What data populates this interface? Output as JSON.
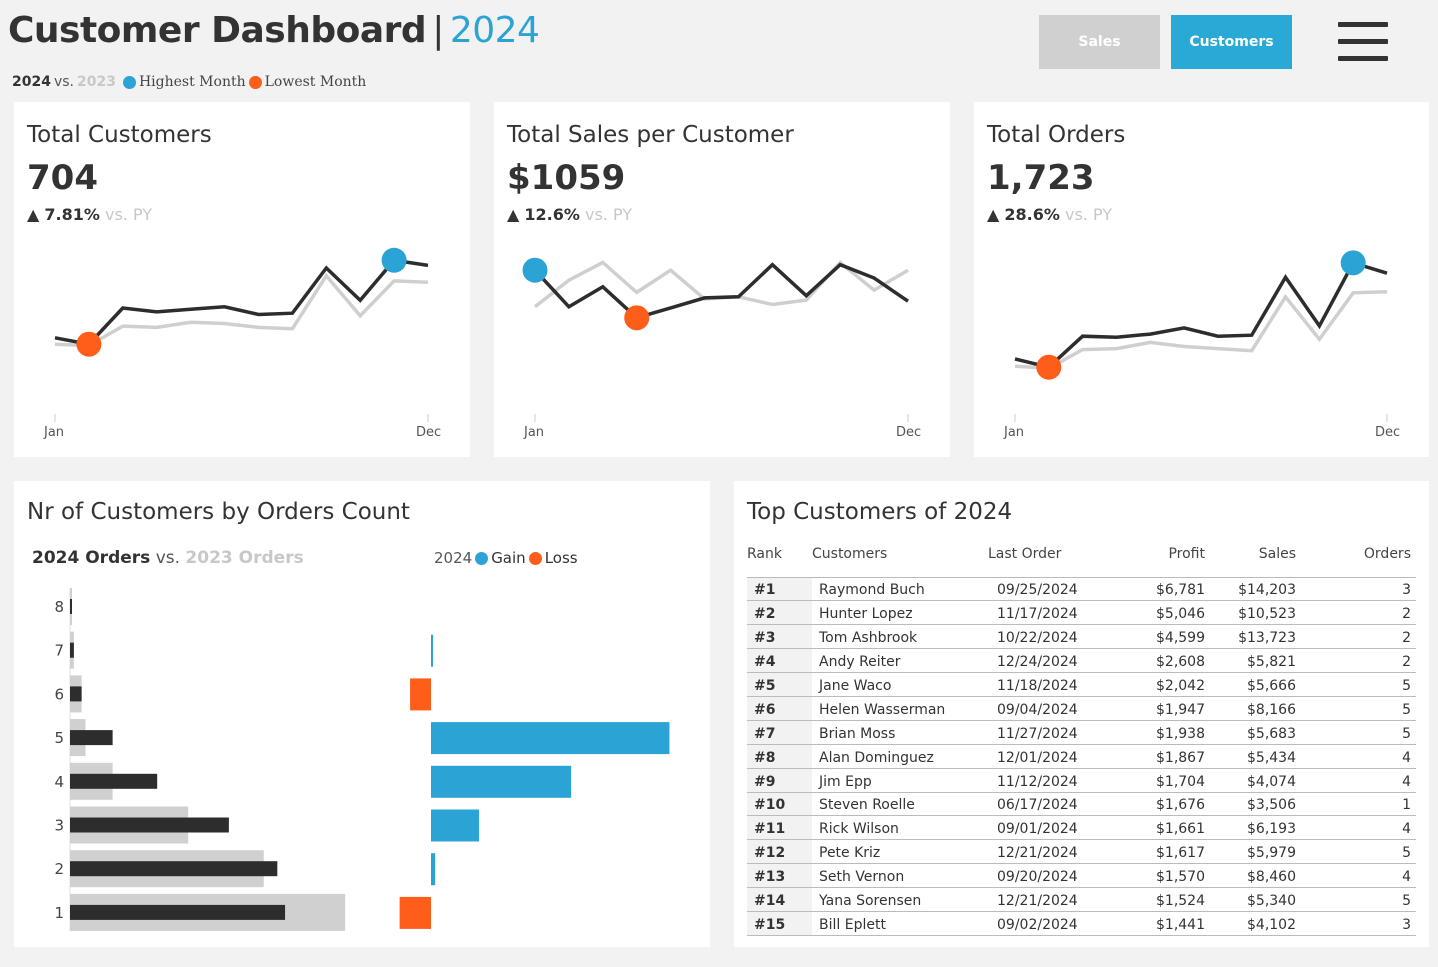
{
  "header": {
    "title": "Customer Dashboard",
    "separator": "|",
    "year": "2024"
  },
  "subtitle": {
    "current_year": "2024",
    "vs": "vs.",
    "prior_year": "2023",
    "highest_label": "Highest Month",
    "lowest_label": "Lowest Month"
  },
  "nav": {
    "sales_label": "Sales",
    "customers_label": "Customers",
    "active": "Customers"
  },
  "colors": {
    "accent_blue": "#2ba3d4",
    "accent_orange": "#ff5e1a",
    "current_line": "#2d2d2d",
    "prior_line": "#cfcfcf",
    "background": "#f2f2f2"
  },
  "kpis": [
    {
      "title": "Total Customers",
      "value": "704",
      "arrow": "▲",
      "delta": "7.81%",
      "vs_label": "vs. PY",
      "x_start": "Jan",
      "x_end": "Dec"
    },
    {
      "title": "Total Sales per Customer",
      "value": "$1059",
      "arrow": "▲",
      "delta": "12.6%",
      "vs_label": "vs. PY",
      "x_start": "Jan",
      "x_end": "Dec"
    },
    {
      "title": "Total Orders",
      "value": "1,723",
      "arrow": "▲",
      "delta": "28.6%",
      "vs_label": "vs. PY",
      "x_start": "Jan",
      "x_end": "Dec"
    }
  ],
  "orders_section": {
    "title": "Nr of Customers by Orders Count",
    "legend_current": "2024 Orders",
    "legend_vs": "vs.",
    "legend_prior": "2023 Orders",
    "legend2_year": "2024",
    "legend2_gain": "Gain",
    "legend2_loss": "Loss"
  },
  "top_customers": {
    "title": "Top Customers of 2024",
    "columns": [
      "Rank",
      "Customers",
      "Last Order",
      "Profit",
      "Sales",
      "Orders"
    ],
    "rows": [
      [
        "#1",
        "Raymond Buch",
        "09/25/2024",
        "$6,781",
        "$14,203",
        "3"
      ],
      [
        "#2",
        "Hunter Lopez",
        "11/17/2024",
        "$5,046",
        "$10,523",
        "2"
      ],
      [
        "#3",
        "Tom Ashbrook",
        "10/22/2024",
        "$4,599",
        "$13,723",
        "2"
      ],
      [
        "#4",
        "Andy Reiter",
        "12/24/2024",
        "$2,608",
        "$5,821",
        "2"
      ],
      [
        "#5",
        "Jane Waco",
        "11/18/2024",
        "$2,042",
        "$5,666",
        "5"
      ],
      [
        "#6",
        "Helen Wasserman",
        "09/04/2024",
        "$1,947",
        "$8,166",
        "5"
      ],
      [
        "#7",
        "Brian Moss",
        "11/27/2024",
        "$1,938",
        "$5,683",
        "5"
      ],
      [
        "#8",
        "Alan Dominguez",
        "12/01/2024",
        "$1,867",
        "$5,434",
        "4"
      ],
      [
        "#9",
        "Jim Epp",
        "11/12/2024",
        "$1,704",
        "$4,074",
        "4"
      ],
      [
        "#10",
        "Steven Roelle",
        "06/17/2024",
        "$1,676",
        "$3,506",
        "1"
      ],
      [
        "#11",
        "Rick Wilson",
        "09/01/2024",
        "$1,661",
        "$6,193",
        "4"
      ],
      [
        "#12",
        "Pete Kriz",
        "12/21/2024",
        "$1,617",
        "$5,979",
        "5"
      ],
      [
        "#13",
        "Seth Vernon",
        "09/20/2024",
        "$1,570",
        "$8,460",
        "4"
      ],
      [
        "#14",
        "Yana Sorensen",
        "12/21/2024",
        "$1,524",
        "$5,340",
        "5"
      ],
      [
        "#15",
        "Bill Eplett",
        "09/02/2024",
        "$1,441",
        "$4,102",
        "3"
      ]
    ]
  },
  "chart_data": [
    {
      "type": "line",
      "x": [
        "Jan",
        "Feb",
        "Mar",
        "Apr",
        "May",
        "Jun",
        "Jul",
        "Aug",
        "Sep",
        "Oct",
        "Nov",
        "Dec"
      ],
      "series": [
        {
          "values": [
            42,
            37,
            65,
            62,
            64,
            66,
            60,
            61,
            96,
            71,
            102,
            98
          ]
        },
        {
          "values": [
            37,
            36,
            51,
            50,
            54,
            53,
            50,
            49,
            90,
            59,
            86,
            85
          ]
        }
      ],
      "highest_index": 10,
      "lowest_index": 1,
      "ylim": [
        0,
        120
      ]
    },
    {
      "type": "line",
      "x": [
        "Jan",
        "Feb",
        "Mar",
        "Apr",
        "May",
        "Jun",
        "Jul",
        "Aug",
        "Sep",
        "Oct",
        "Nov",
        "Dec"
      ],
      "series": [
        {
          "values": [
            110,
            77,
            95,
            67,
            76,
            85,
            86,
            115,
            87,
            115,
            103,
            82
          ]
        },
        {
          "values": [
            77,
            101,
            117,
            90,
            110,
            84,
            86,
            79,
            83,
            117,
            92,
            110
          ]
        }
      ],
      "highest_index": 0,
      "lowest_index": 3,
      "ylim": [
        0,
        140
      ]
    },
    {
      "type": "line",
      "x": [
        "Jan",
        "Feb",
        "Mar",
        "Apr",
        "May",
        "Jun",
        "Jul",
        "Aug",
        "Sep",
        "Oct",
        "Nov",
        "Dec"
      ],
      "series": [
        {
          "values": [
            32,
            24,
            54,
            53,
            56,
            62,
            54,
            55,
            111,
            64,
            125,
            115
          ]
        },
        {
          "values": [
            25,
            23,
            41,
            42,
            48,
            44,
            42,
            40,
            92,
            51,
            96,
            97
          ]
        }
      ],
      "highest_index": 10,
      "lowest_index": 1,
      "ylim": [
        0,
        150
      ]
    },
    {
      "type": "bar",
      "orientation": "horizontal",
      "categories": [
        "8",
        "7",
        "6",
        "5",
        "4",
        "3",
        "2",
        "1"
      ],
      "series": [
        {
          "values": [
            1,
            2,
            6,
            22,
            45,
            82,
            107,
            111
          ]
        },
        {
          "values": [
            1,
            2,
            6,
            8,
            22,
            61,
            100,
            142
          ]
        }
      ],
      "xlim": [
        0,
        160
      ]
    },
    {
      "type": "bar",
      "orientation": "horizontal",
      "categories": [
        "8",
        "7",
        "6",
        "5",
        "4",
        "3",
        "2",
        "1"
      ],
      "values": [
        0,
        0.5,
        -10,
        114,
        67,
        23,
        2,
        -15
      ],
      "xlim": [
        -20,
        120
      ]
    }
  ]
}
